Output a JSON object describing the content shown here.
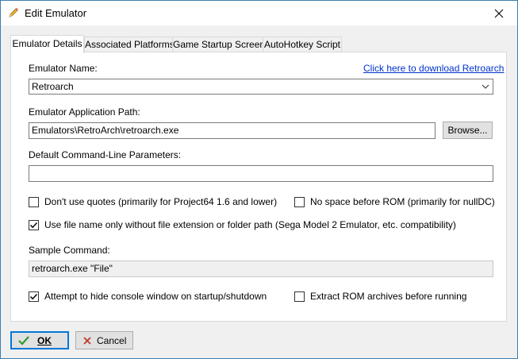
{
  "window": {
    "title": "Edit Emulator"
  },
  "tabs": [
    {
      "label": "Emulator Details",
      "active": true
    },
    {
      "label": "Associated Platforms",
      "active": false
    },
    {
      "label": "Game Startup Screen",
      "active": false
    },
    {
      "label": "AutoHotkey Script",
      "active": false
    }
  ],
  "details": {
    "name_label": "Emulator Name:",
    "download_link": "Click here to download Retroarch",
    "name_value": "Retroarch",
    "path_label": "Emulator Application Path:",
    "path_value": "Emulators\\RetroArch\\retroarch.exe",
    "browse_label": "Browse...",
    "params_label": "Default Command-Line Parameters:",
    "params_value": "",
    "no_quotes_label": "Don't use quotes (primarily for Project64 1.6 and lower)",
    "no_quotes_checked": false,
    "no_space_label": "No space before ROM (primarily for nullDC)",
    "no_space_checked": false,
    "filename_only_label": "Use file name only without file extension or folder path (Sega Model 2 Emulator, etc. compatibility)",
    "filename_only_checked": true,
    "sample_label": "Sample Command:",
    "sample_value": "retroarch.exe \"File\"",
    "hide_console_label": "Attempt to hide console window on startup/shutdown",
    "hide_console_checked": true,
    "extract_label": "Extract ROM archives before running",
    "extract_checked": false
  },
  "footer": {
    "ok_label": "OK",
    "cancel_label": "Cancel"
  },
  "colors": {
    "link": "#0033cc",
    "accent": "#0078d7",
    "ok_check": "#2e9b2e",
    "cancel_x": "#c0392b"
  }
}
